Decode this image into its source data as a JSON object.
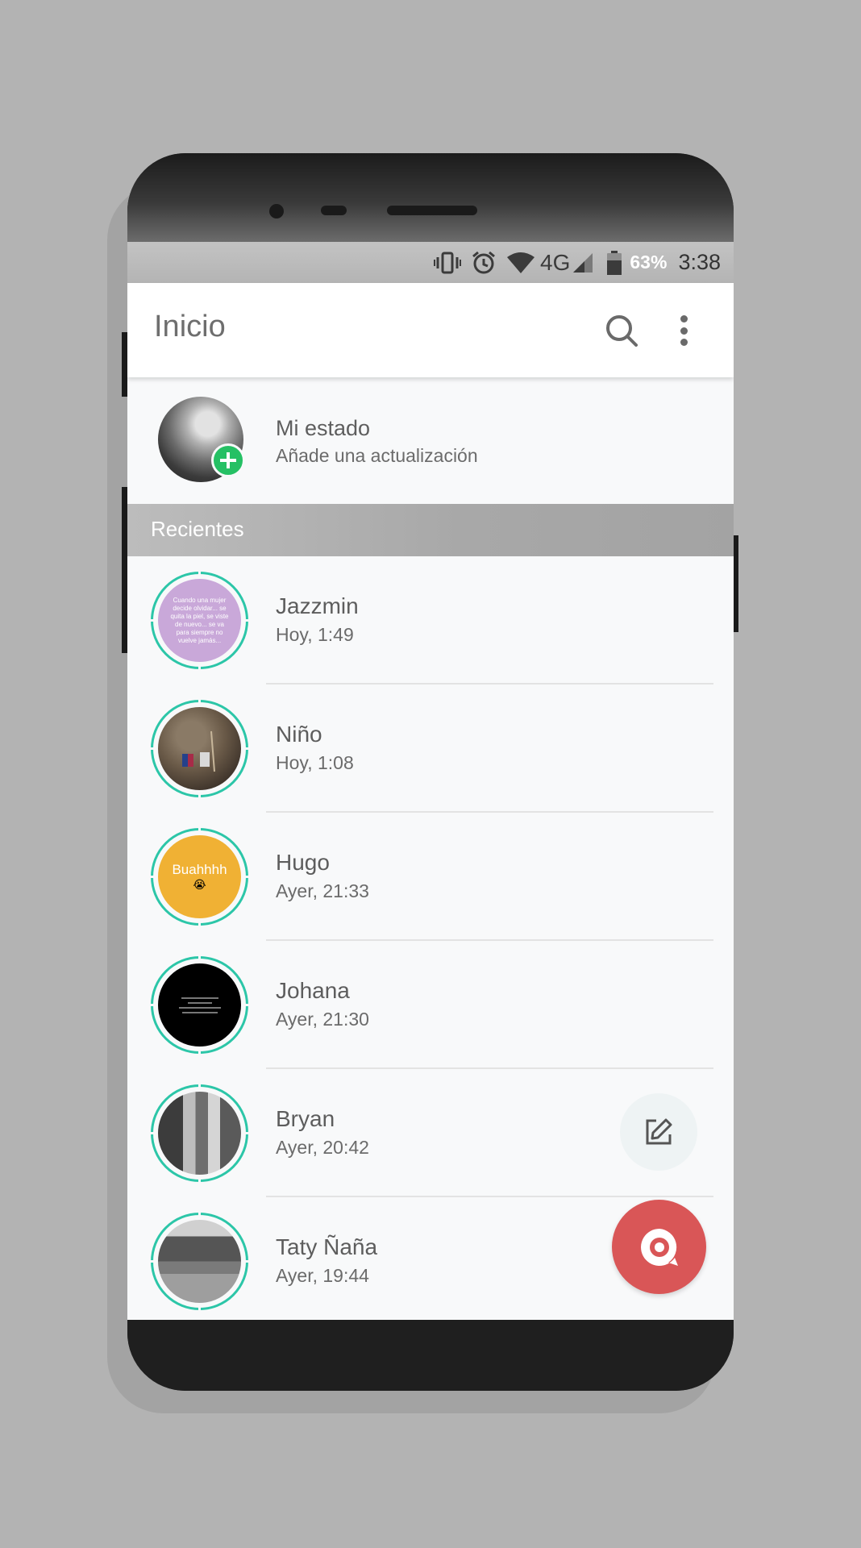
{
  "status_bar": {
    "network": "4G",
    "battery": "63%",
    "time": "3:38",
    "icons": [
      "vibrate-icon",
      "alarm-icon",
      "wifi-icon",
      "signal-icon",
      "battery-icon"
    ]
  },
  "app_bar": {
    "title": "Inicio",
    "actions": [
      "search-icon",
      "more-vert-icon"
    ]
  },
  "my_status": {
    "name": "Mi estado",
    "subtitle": "Añade una actualización"
  },
  "section": {
    "label": "Recientes"
  },
  "recent": [
    {
      "name": "Jazzmin",
      "time": "Hoy, 1:49",
      "thumb_bg": "#c9a8d9",
      "thumb_text": "Cuando una mujer decide olvidar... se quita la piel, se viste de nuevo... se va para siempre no vuelve jamás..."
    },
    {
      "name": "Niño",
      "time": "Hoy, 1:08",
      "thumb_bg": "#5a4a3a"
    },
    {
      "name": "Hugo",
      "time": "Ayer, 21:33",
      "thumb_bg": "#f0b134",
      "thumb_text": "Buahhhh"
    },
    {
      "name": "Johana",
      "time": "Ayer, 21:30",
      "thumb_bg": "#000000"
    },
    {
      "name": "Bryan",
      "time": "Ayer, 20:42",
      "thumb_bg": "#9a9a9a"
    },
    {
      "name": "Taty Ñaña",
      "time": "Ayer, 19:44",
      "thumb_bg": "#8a8a8a"
    }
  ],
  "colors": {
    "ring": "#2cc6a8",
    "fab_main": "#d95657",
    "add_badge": "#25c064"
  },
  "fabs": {
    "edit": "edit-icon",
    "camera": "camera-icon"
  }
}
